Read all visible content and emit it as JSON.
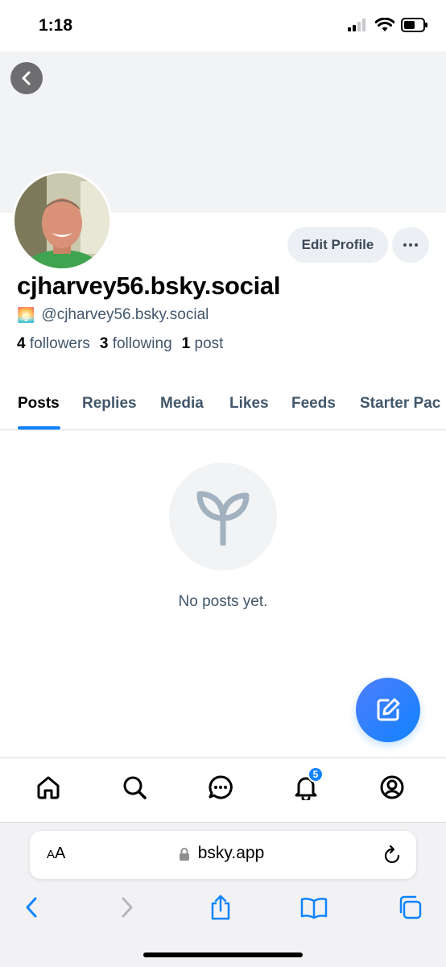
{
  "status_bar": {
    "time": "1:18"
  },
  "profile": {
    "display_name": "cjharvey56.bsky.social",
    "handle_emoji": "🌅",
    "handle": "@cjharvey56.bsky.social",
    "stats": {
      "followers_count": "4",
      "followers_label": "followers",
      "following_count": "3",
      "following_label": "following",
      "posts_count": "1",
      "posts_label": "post"
    },
    "edit_profile_label": "Edit Profile"
  },
  "tabs": [
    {
      "label": "Posts",
      "active": true
    },
    {
      "label": "Replies",
      "active": false
    },
    {
      "label": "Media",
      "active": false
    },
    {
      "label": "Likes",
      "active": false
    },
    {
      "label": "Feeds",
      "active": false
    },
    {
      "label": "Starter Pac",
      "active": false
    }
  ],
  "empty_state": {
    "icon": "seedling-icon",
    "message": "No posts yet."
  },
  "bottom_nav": {
    "items": [
      "home-icon",
      "search-icon",
      "chat-icon",
      "notifications-icon",
      "profile-icon"
    ],
    "notifications_badge": "5"
  },
  "browser": {
    "text_size_label": "AA",
    "url": "bsky.app"
  },
  "colors": {
    "accent": "#1083fe",
    "muted_text": "#42576c",
    "banner": "#f1f3f5"
  }
}
